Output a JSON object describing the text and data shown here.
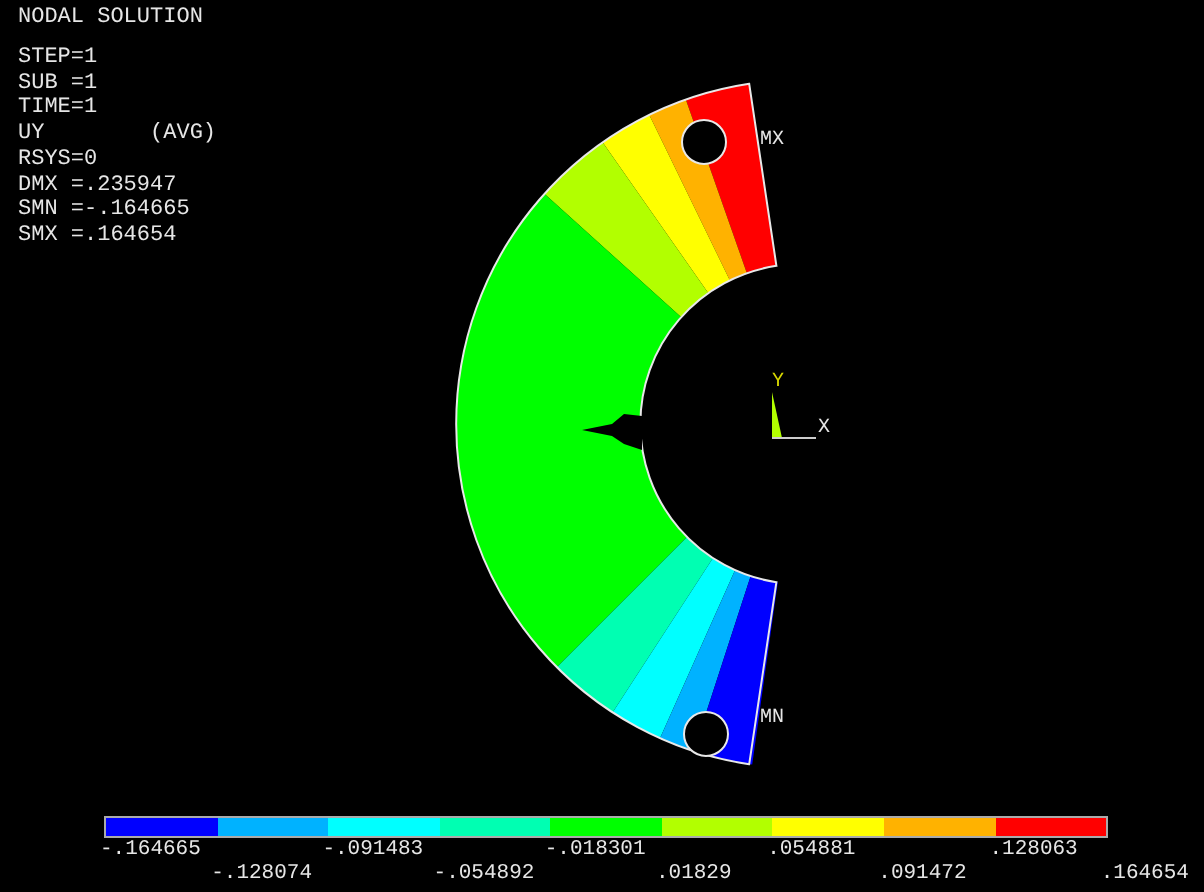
{
  "title": "NODAL SOLUTION",
  "info": [
    "STEP=1",
    "SUB =1",
    "TIME=1",
    "UY        (AVG)",
    "RSYS=0",
    "DMX =.235947",
    "SMN =-.164665",
    "SMX =.164654"
  ],
  "markers": [
    {
      "kind": "max",
      "label": "MX"
    },
    {
      "kind": "min",
      "label": "MN"
    }
  ],
  "triad": {
    "y": "Y",
    "x": "X"
  },
  "legend": {
    "bands": [
      {
        "color": "#0000ff"
      },
      {
        "color": "#00b2ff"
      },
      {
        "color": "#00ffff"
      },
      {
        "color": "#00ffb2"
      },
      {
        "color": "#00ff00"
      },
      {
        "color": "#b2ff00"
      },
      {
        "color": "#ffff00"
      },
      {
        "color": "#ffb200"
      },
      {
        "color": "#ff0000"
      }
    ],
    "labels": [
      "-.164665",
      "-.128074",
      "-.091483",
      "-.054892",
      "-.018301",
      ".01829",
      ".054881",
      ".091472",
      ".128063",
      ".164654"
    ]
  }
}
